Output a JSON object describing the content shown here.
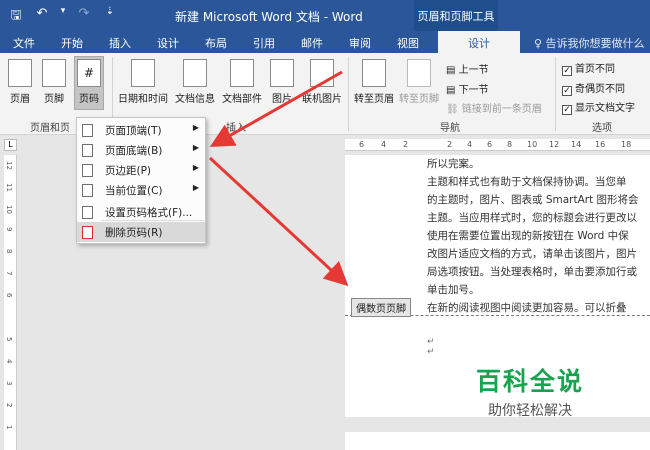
{
  "titlebar": {
    "doc_title": "新建 Microsoft Word 文档 - Word",
    "context_group": "页眉和页脚工具",
    "qat": {
      "save": "🖫",
      "undo": "↶",
      "undo_arrow": "▾",
      "redo": "↷",
      "customize": "⇣"
    }
  },
  "tabs": [
    "文件",
    "开始",
    "插入",
    "设计",
    "布局",
    "引用",
    "邮件",
    "审阅",
    "视图"
  ],
  "active_tab": "设计",
  "tell_me": "♀ 告诉我你想要做什么",
  "ribbon": {
    "header": "页眉",
    "footer": "页脚",
    "page_number": "页码",
    "page_number_glyph": "#",
    "date_time": "日期和时间",
    "doc_info": "文档信息",
    "doc_parts": "文档部件",
    "picture": "图片",
    "online_picture": "联机图片",
    "goto_header": "转至页眉",
    "goto_footer": "转至页脚",
    "prev": "上一节",
    "next": "下一节",
    "link_prev": "链接到前一条页眉",
    "diff_first": "首页不同",
    "diff_odd_even": "奇偶页不同",
    "show_text": "显示文档文字",
    "group_hf": "页眉和页",
    "group_insert": "插入",
    "group_nav": "导航",
    "group_options": "选项"
  },
  "menu": {
    "items": [
      {
        "label": "页面顶端(T)",
        "sub": true
      },
      {
        "label": "页面底端(B)",
        "sub": true
      },
      {
        "label": "页边距(P)",
        "sub": true
      },
      {
        "label": "当前位置(C)",
        "sub": true
      },
      {
        "label": "设置页码格式(F)...",
        "sub": false
      },
      {
        "label": "删除页码(R)",
        "sub": false
      }
    ],
    "submenu_arrow": "▶"
  },
  "ruler": {
    "h": [
      "6",
      "4",
      "2",
      "2",
      "4",
      "6",
      "8",
      "10",
      "12",
      "14",
      "16",
      "18"
    ],
    "v": [
      "12",
      "11",
      "10",
      "9",
      "8",
      "7",
      "6",
      "5",
      "4",
      "3",
      "2",
      "1"
    ],
    "corner": "L"
  },
  "document": {
    "lines": [
      "所以完案。",
      "主题和样式也有助于文档保持协调。当您单",
      "的主题时，图片、图表或 SmartArt 图形将会",
      "主题。当应用样式时，您的标题会进行更改以",
      "使用在需要位置出现的新按钮在 Word 中保",
      "改图片适应文档的方式，请单击该图片，图片",
      "局选项按钮。当处理表格时，单击要添加行或",
      "单击加号。",
      "在新的阅读视图中阅读更加容易。可以折叠"
    ],
    "footer_tag": "偶数页页脚",
    "return_mark": "↵"
  },
  "watermark": {
    "title": "百科全说",
    "subtitle": "助你轻松解决"
  }
}
